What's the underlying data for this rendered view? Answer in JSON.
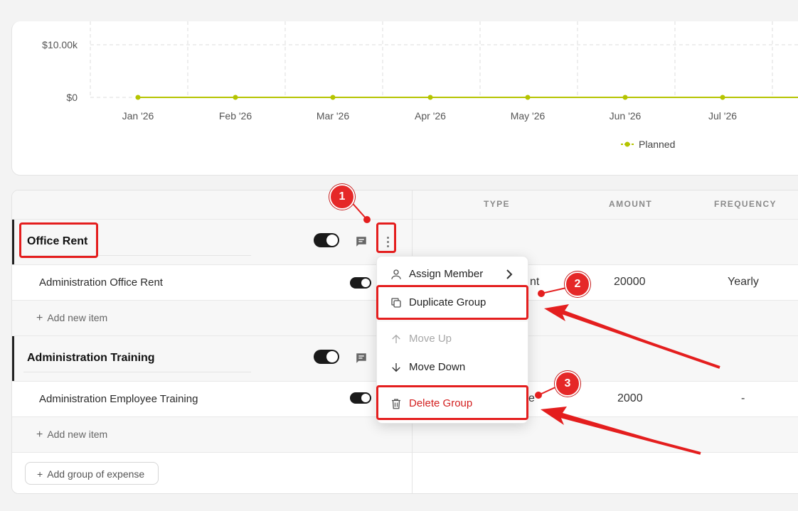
{
  "chart_data": {
    "type": "line",
    "x": [
      "Jan '26",
      "Feb '26",
      "Mar '26",
      "Apr '26",
      "May '26",
      "Jun '26",
      "Jul '26"
    ],
    "y_tick_labels": [
      "$10.00k",
      "$0"
    ],
    "ylim": [
      0,
      10000
    ],
    "series": [
      {
        "name": "Planned",
        "values": [
          0,
          0,
          0,
          0,
          0,
          0,
          0
        ],
        "color": "#b5c400"
      }
    ],
    "grid": true,
    "legend": "bottom-center"
  },
  "table": {
    "columns": {
      "type": "TYPE",
      "amount": "AMOUNT",
      "frequency": "FREQUENCY"
    },
    "groups": [
      {
        "name": "Office Rent",
        "items": [
          {
            "name": "Administration Office Rent",
            "type_partial": "nt",
            "amount": "20000",
            "frequency": "Yearly"
          }
        ],
        "add_item": "Add new item"
      },
      {
        "name": "Administration Training",
        "items": [
          {
            "name": "Administration Employee Training",
            "type_partial": "e",
            "amount": "2000",
            "frequency": "-"
          }
        ],
        "add_item": "Add new item"
      }
    ],
    "add_group": "Add group of expense"
  },
  "menu": {
    "items": [
      {
        "label": "Assign Member",
        "icon": "user-icon"
      },
      {
        "label": "Duplicate Group",
        "icon": "copy-icon"
      },
      {
        "label": "Move Up",
        "icon": "arrow-up-icon",
        "disabled": true
      },
      {
        "label": "Move Down",
        "icon": "arrow-down-icon"
      },
      {
        "label": "Delete Group",
        "icon": "trash-icon",
        "danger": true
      }
    ]
  },
  "annotations": {
    "markers": [
      "1",
      "2",
      "3"
    ],
    "color": "#e41e1e"
  }
}
